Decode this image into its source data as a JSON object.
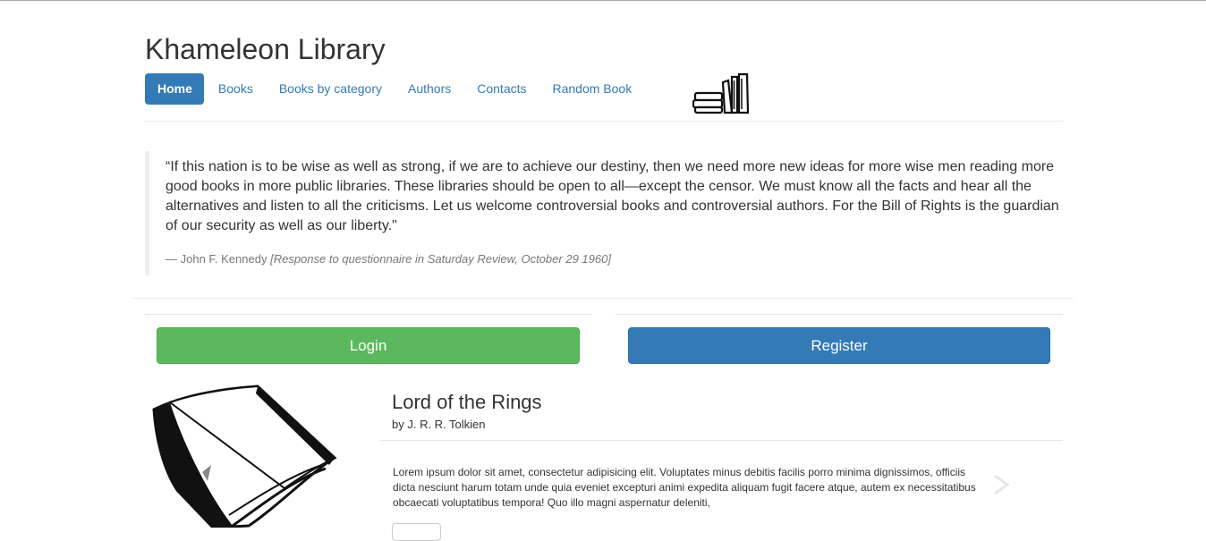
{
  "site": {
    "title": "Khameleon Library"
  },
  "nav": {
    "items": [
      {
        "label": "Home",
        "active": true
      },
      {
        "label": "Books",
        "active": false
      },
      {
        "label": "Books by category",
        "active": false
      },
      {
        "label": "Authors",
        "active": false
      },
      {
        "label": "Contacts",
        "active": false
      },
      {
        "label": "Random Book",
        "active": false
      }
    ],
    "icon": "books-stack-icon"
  },
  "quote": {
    "text": "“If this nation is to be wise as well as strong, if we are to achieve our destiny, then we need more new ideas for more wise men reading more good books in more public libraries. These libraries should be open to all—except the censor. We must know all the facts and hear all the alternatives and listen to all the criticisms. Let us welcome controversial books and controversial authors. For the Bill of Rights is the guardian of our security as well as our liberty.\"",
    "attribution": "— John F. Kennedy",
    "source": "[Response to questionnaire in Saturday Review, October 29 1960]"
  },
  "auth": {
    "login_label": "Login",
    "register_label": "Register"
  },
  "featured_book": {
    "title": "Lord of the Rings",
    "author": "by J. R. R. Tolkien",
    "description": "Lorem ipsum dolor sit amet, consectetur adipisicing elit. Voluptates minus debitis facilis porro minima dignissimos, officiis dicta nesciunt harum totam unde quia eveniet excepturi animi expedita aliquam fugit facere atque, autem ex necessitatibus obcaecati voluptatibus tempora! Quo illo magni aspernatur deleniti,",
    "cover_icon": "book-cover-icon",
    "next_icon": "chevron-right-icon"
  },
  "colors": {
    "primary": "#337ab7",
    "success": "#5cb85c",
    "muted": "#777777"
  }
}
